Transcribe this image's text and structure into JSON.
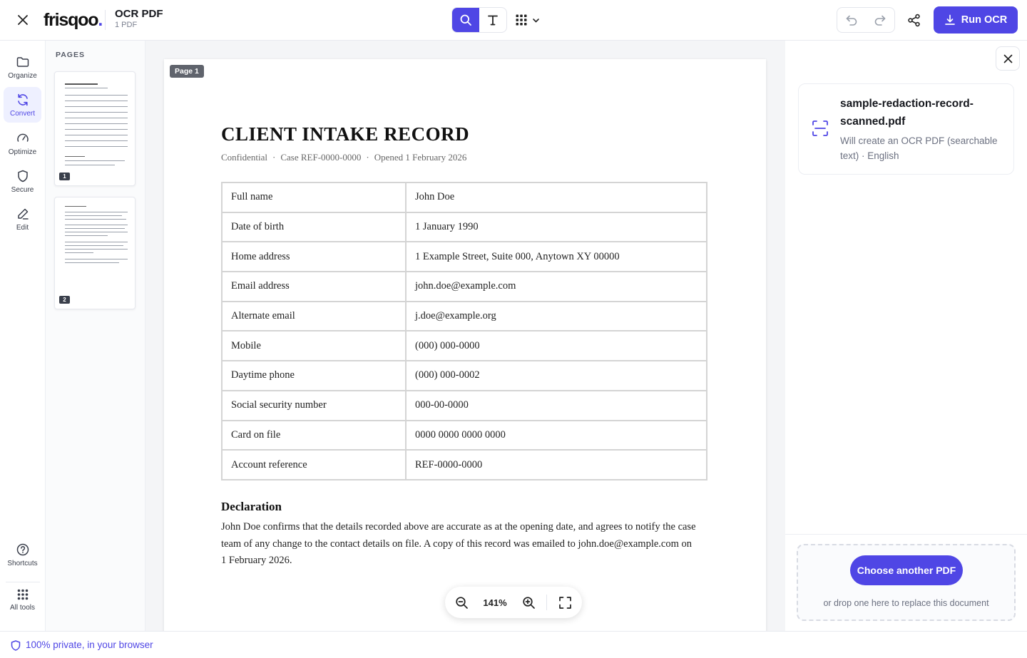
{
  "app": {
    "brand": "frisqoo",
    "brand_dot": ".",
    "doc_title": "OCR PDF",
    "doc_count": "1 PDF",
    "run_label": "Run OCR"
  },
  "rail": {
    "items": [
      {
        "label": "Organize"
      },
      {
        "label": "Convert"
      },
      {
        "label": "Optimize"
      },
      {
        "label": "Secure"
      },
      {
        "label": "Edit"
      }
    ],
    "bottom": [
      {
        "label": "Shortcuts"
      },
      {
        "label": "All tools"
      }
    ]
  },
  "pages_panel": {
    "label": "PAGES",
    "thumbs": [
      "1",
      "2"
    ]
  },
  "document": {
    "page_tag": "Page 1",
    "title": "CLIENT INTAKE RECORD",
    "meta": [
      "Confidential",
      "Case REF-0000-0000",
      "Opened 1 February 2026"
    ],
    "meta_sep": "·",
    "rows": [
      {
        "k": "Full name",
        "v": "John Doe"
      },
      {
        "k": "Date of birth",
        "v": "1 January 1990"
      },
      {
        "k": "Home address",
        "v": "1 Example Street, Suite 000, Anytown XY 00000"
      },
      {
        "k": "Email address",
        "v": "john.doe@example.com"
      },
      {
        "k": "Alternate email",
        "v": "j.doe@example.org"
      },
      {
        "k": "Mobile",
        "v": "(000) 000-0000"
      },
      {
        "k": "Daytime phone",
        "v": "(000) 000-0002"
      },
      {
        "k": "Social security number",
        "v": "000-00-0000"
      },
      {
        "k": "Card on file",
        "v": "0000 0000 0000 0000"
      },
      {
        "k": "Account reference",
        "v": "REF-0000-0000"
      }
    ],
    "declaration_title": "Declaration",
    "declaration_text": "John Doe confirms that the details recorded above are accurate as at the opening date, and agrees to notify the case team of any change to the contact details on file. A copy of this record was emailed to john.doe@example.com on 1 February 2026."
  },
  "zoom": {
    "value": "141%"
  },
  "right_panel": {
    "file_name": "sample-redaction-record-scanned.pdf",
    "file_desc": "Will create an OCR PDF (searchable text) · English",
    "choose_label": "Choose another PDF",
    "drop_hint": "or drop one here to replace this document"
  },
  "footer": {
    "text": "100% private, in your browser"
  },
  "colors": {
    "accent": "#4f46e5"
  }
}
